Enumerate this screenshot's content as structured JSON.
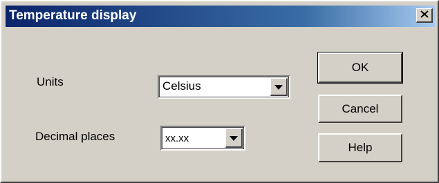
{
  "window": {
    "title": "Temperature display"
  },
  "fields": {
    "units": {
      "label": "Units",
      "value": "Celsius"
    },
    "decimal_places": {
      "label": "Decimal places",
      "value": "xx.xx"
    }
  },
  "buttons": {
    "ok": "OK",
    "cancel": "Cancel",
    "help": "Help"
  },
  "icons": {
    "close": "close-icon",
    "dropdown": "chevron-down-icon"
  },
  "colors": {
    "titlebar_start": "#0a246a",
    "titlebar_end": "#a6caf0",
    "dialog_face": "#d4d0c8"
  }
}
